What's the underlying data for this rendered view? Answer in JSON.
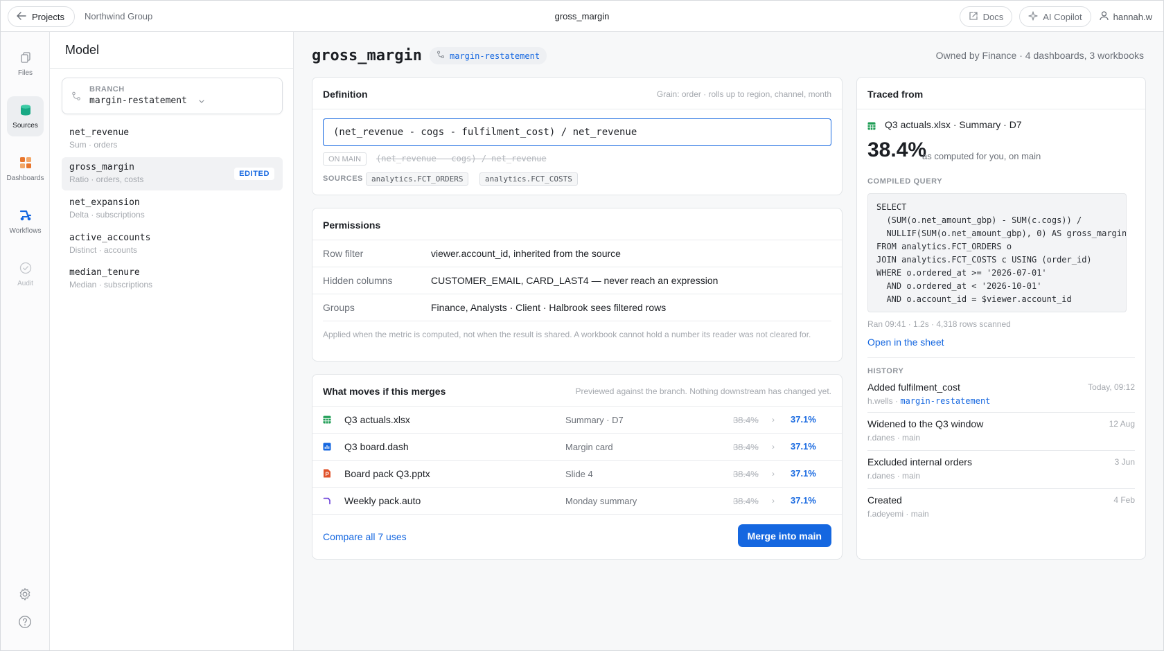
{
  "topbar": {
    "back_label": "Projects",
    "org": "Northwind Group",
    "title": "gross_margin",
    "docs_label": "Docs",
    "copilot_label": "AI Copilot",
    "user": "hannah.w"
  },
  "rail": {
    "items": [
      {
        "label": "Files"
      },
      {
        "label": "Sources"
      },
      {
        "label": "Dashboards"
      },
      {
        "label": "Workflows"
      },
      {
        "label": "Audit"
      }
    ]
  },
  "model": {
    "title": "Model",
    "branch_label": "BRANCH",
    "branch_value": "margin-restatement",
    "metrics": [
      {
        "name": "net_revenue",
        "desc": "Sum · orders"
      },
      {
        "name": "gross_margin",
        "desc": "Ratio · orders, costs",
        "badge": "EDITED"
      },
      {
        "name": "net_expansion",
        "desc": "Delta · subscriptions"
      },
      {
        "name": "active_accounts",
        "desc": "Distinct · accounts"
      },
      {
        "name": "median_tenure",
        "desc": "Median · subscriptions"
      }
    ]
  },
  "main": {
    "title": "gross_margin",
    "branch": "margin-restatement",
    "owner": "Owned by Finance · 4 dashboards, 3 workbooks"
  },
  "definition": {
    "title": "Definition",
    "note": "Grain: order · rolls up to region, channel, month",
    "formula": "(net_revenue - cogs - fulfilment_cost) / net_revenue",
    "on_main_label": "ON MAIN",
    "on_main_formula": "(net_revenue - cogs) / net_revenue",
    "sources_label": "SOURCES",
    "sources": [
      "analytics.FCT_ORDERS",
      "analytics.FCT_COSTS"
    ]
  },
  "permissions": {
    "title": "Permissions",
    "rows": [
      {
        "key": "Row filter",
        "value": "viewer.account_id, inherited from the source"
      },
      {
        "key": "Hidden columns",
        "value": "CUSTOMER_EMAIL, CARD_LAST4 — never reach an expression"
      },
      {
        "key": "Groups",
        "value": "Finance, Analysts · Client · Halbrook sees filtered rows"
      }
    ],
    "note": "Applied when the metric is computed, not when the result is shared. A workbook cannot hold a number its reader was not cleared for."
  },
  "moves": {
    "title": "What moves if this merges",
    "note": "Previewed against the branch. Nothing downstream has changed yet.",
    "rows": [
      {
        "icon": "spreadsheet-icon",
        "name": "Q3 actuals.xlsx",
        "location": "Summary · D7",
        "old": "38.4%",
        "new": "37.1%",
        "color": "#1f9d55"
      },
      {
        "icon": "dashboard-icon",
        "name": "Q3 board.dash",
        "location": "Margin card",
        "old": "38.4%",
        "new": "37.1%",
        "color": "#1567e0"
      },
      {
        "icon": "presentation-icon",
        "name": "Board pack Q3.pptx",
        "location": "Slide 4",
        "old": "38.4%",
        "new": "37.1%",
        "color": "#e0532b"
      },
      {
        "icon": "workflow-icon",
        "name": "Weekly pack.auto",
        "location": "Monday summary",
        "old": "38.4%",
        "new": "37.1%",
        "color": "#6a3fd8"
      }
    ],
    "compare_label": "Compare all 7 uses",
    "merge_label": "Merge into main"
  },
  "traced": {
    "title": "Traced from",
    "source": "Q3 actuals.xlsx · Summary · D7",
    "value": "38.4%",
    "value_sub": "as computed for you, on main",
    "query_label": "COMPILED QUERY",
    "query": "SELECT\n  (SUM(o.net_amount_gbp) - SUM(c.cogs)) /\n  NULLIF(SUM(o.net_amount_gbp), 0) AS gross_margin\nFROM analytics.FCT_ORDERS o\nJOIN analytics.FCT_COSTS c USING (order_id)\nWHERE o.ordered_at >= '2026-07-01'\n  AND o.ordered_at < '2026-10-01'\n  AND o.account_id = $viewer.account_id",
    "run_info": "Ran 09:41 · 1.2s · 4,318 rows scanned",
    "open_label": "Open in the sheet",
    "history_label": "HISTORY",
    "history": [
      {
        "title": "Added fulfilment_cost",
        "author": "h.wells",
        "branch": "margin-restatement",
        "date": "Today, 09:12"
      },
      {
        "title": "Widened to the Q3 window",
        "author": "r.danes",
        "branch": "main",
        "date": "12 Aug"
      },
      {
        "title": "Excluded internal orders",
        "author": "r.danes",
        "branch": "main",
        "date": "3 Jun"
      },
      {
        "title": "Created",
        "author": "f.adeyemi",
        "branch": "main",
        "date": "4 Feb"
      }
    ]
  },
  "colors": {
    "accent": "#1567e0",
    "sources_icon": "#17a884",
    "dashboards_icon": "#e8762d",
    "workflows_icon": "#1567e0"
  }
}
